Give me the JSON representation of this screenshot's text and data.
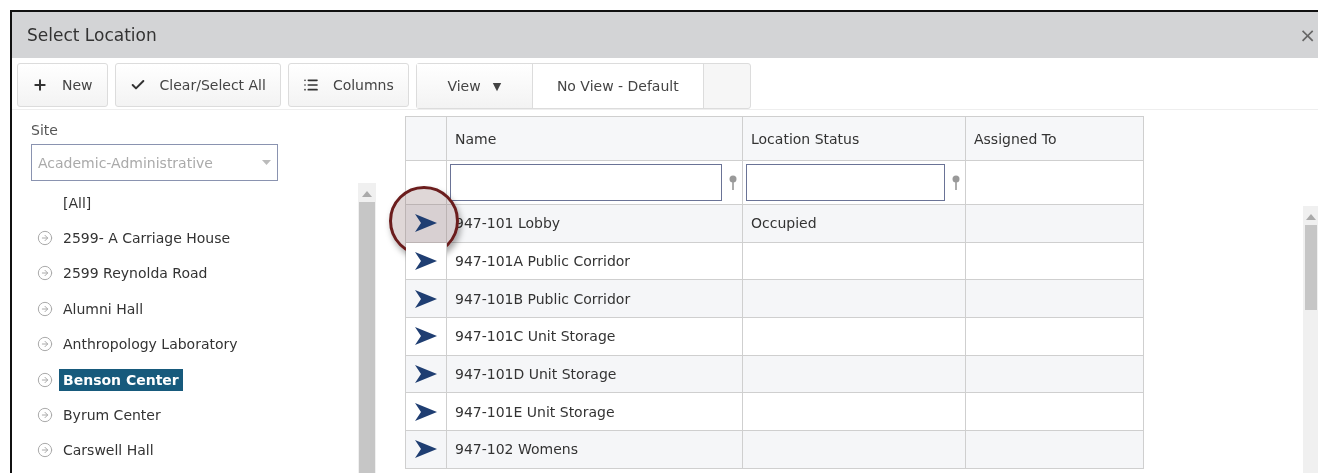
{
  "window": {
    "title": "Select Location",
    "close": "×"
  },
  "toolbar": {
    "buttons": [
      {
        "kind": "new",
        "label": "New"
      },
      {
        "kind": "check",
        "label": "Clear/Select All"
      },
      {
        "kind": "columns",
        "label": "Columns"
      }
    ],
    "view": {
      "label": "View",
      "caret": "▼",
      "current": "No View - Default"
    }
  },
  "site": {
    "label": "Site",
    "placeholder": "Academic-Administrative"
  },
  "sites": [
    {
      "kind": "all",
      "label": "[All]",
      "selected": false
    },
    {
      "kind": "site",
      "label": "2599- A Carriage House",
      "selected": false
    },
    {
      "kind": "site",
      "label": "2599 Reynolda Road",
      "selected": false
    },
    {
      "kind": "site",
      "label": "Alumni Hall",
      "selected": false
    },
    {
      "kind": "site",
      "label": "Anthropology Laboratory",
      "selected": false
    },
    {
      "kind": "site",
      "label": "Benson Center",
      "selected": true
    },
    {
      "kind": "site",
      "label": "Byrum Center",
      "selected": false
    },
    {
      "kind": "site",
      "label": "Carswell Hall",
      "selected": false
    }
  ],
  "grid": {
    "columns": [
      {
        "label": "Name",
        "filter": true
      },
      {
        "label": "Location Status",
        "filter": true
      },
      {
        "label": "Assigned To",
        "filter": false
      }
    ],
    "rows": [
      {
        "name": "947-101 Lobby",
        "status": "Occupied",
        "callout": true
      },
      {
        "name": "947-101A Public Corridor",
        "callout": false
      },
      {
        "name": "947-101B Public Corridor",
        "callout": false
      },
      {
        "name": "947-101C Unit Storage",
        "callout": false
      },
      {
        "name": "947-101D Unit Storage",
        "callout": false
      },
      {
        "name": "947-101E Unit Storage",
        "callout": false
      },
      {
        "name": "947-102 Womens",
        "callout": false
      }
    ]
  }
}
